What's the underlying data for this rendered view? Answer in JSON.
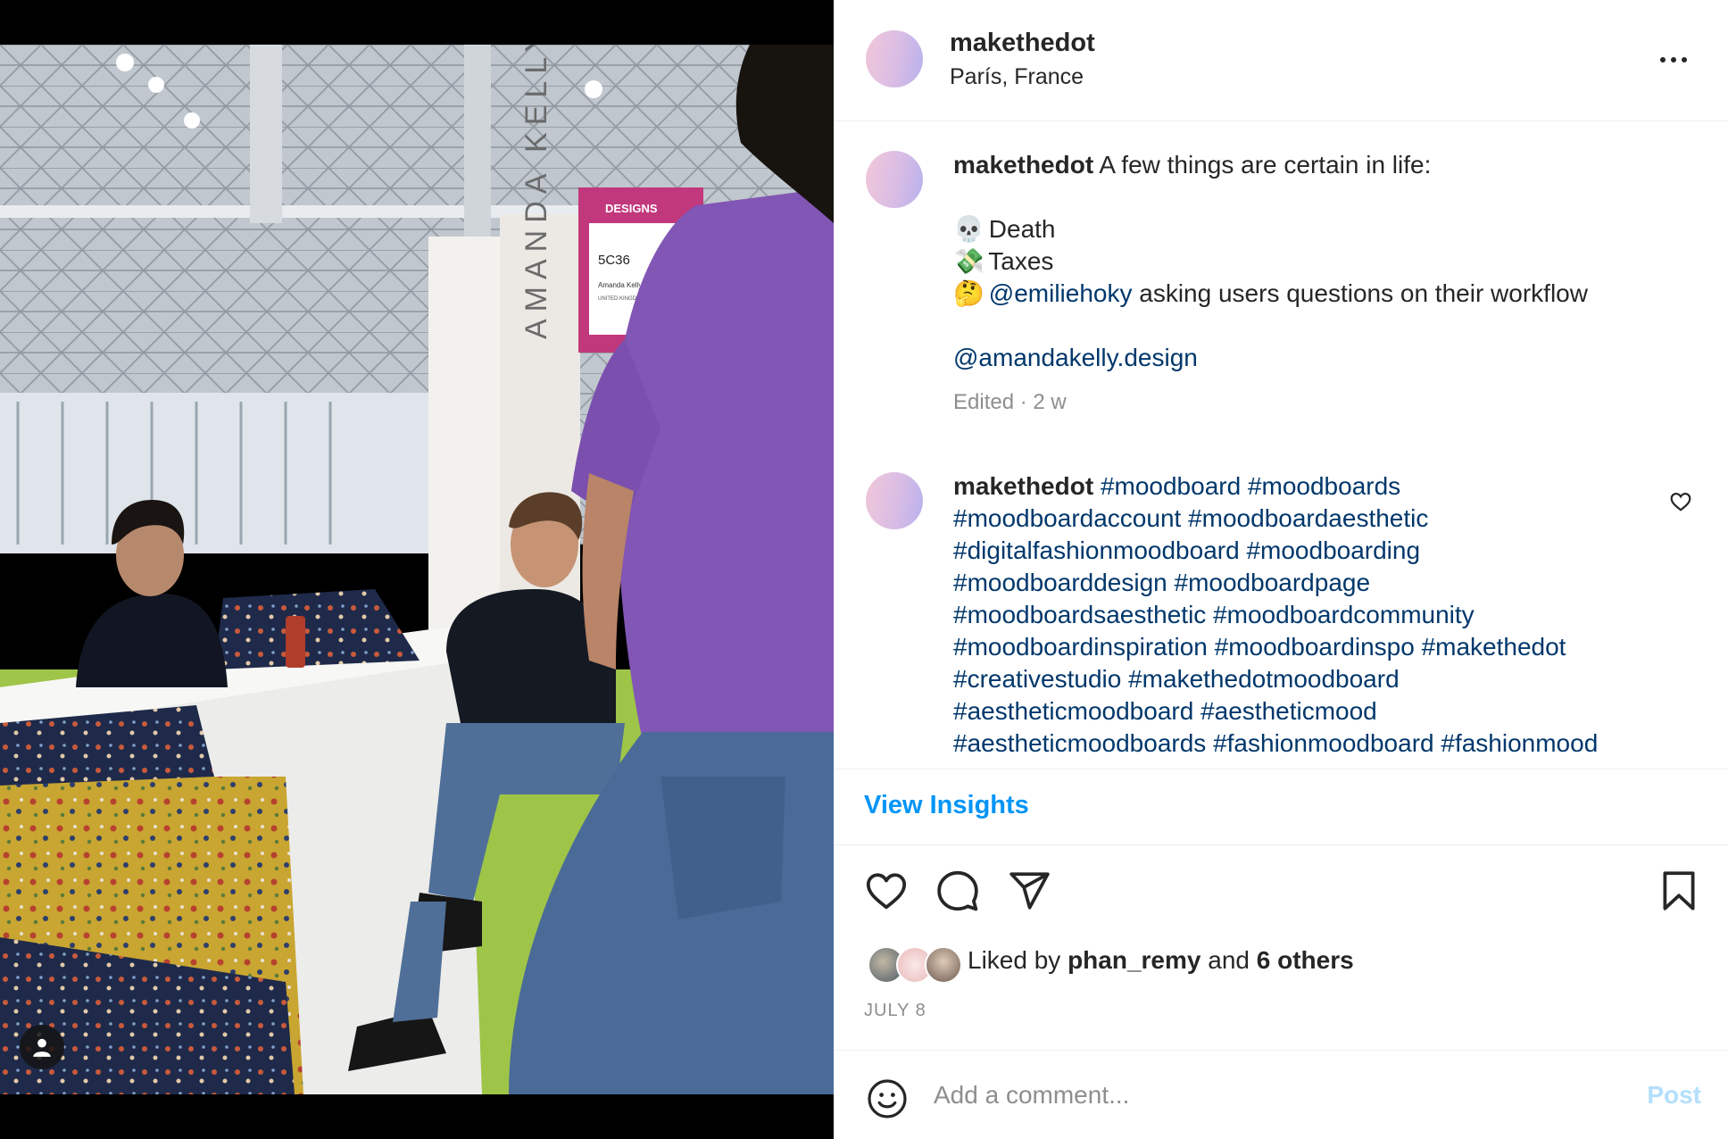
{
  "post": {
    "username": "makethedot",
    "location": "París, France"
  },
  "caption": {
    "username": "makethedot",
    "intro": "A few things are certain in life:",
    "items": [
      {
        "emoji": "💀",
        "text": "Death"
      },
      {
        "emoji": "💸",
        "text": "Taxes"
      },
      {
        "emoji": "🤔",
        "mention": "@emiliehoky",
        "text": "asking users questions on their workflow"
      }
    ],
    "mention_footer": "@amandakelly.design",
    "meta": "Edited · 2 w"
  },
  "hashtag_comment": {
    "username": "makethedot",
    "lines": [
      "#moodboard #moodboards",
      "#moodboardaccount #moodboardaesthetic",
      "#digitalfashionmoodboard #moodboarding",
      "#moodboarddesign #moodboardpage",
      "#moodboardsaesthetic #moodboardcommunity",
      "#moodboardinspiration #moodboardinspo #makethedot",
      "#creativestudio #makethedotmoodboard",
      "#aestheticmoodboard #aestheticmood",
      "#aestheticmoodboards #fashionmoodboard #fashionmood"
    ]
  },
  "insights": {
    "label": "View Insights"
  },
  "likes": {
    "prefix": "Liked by",
    "user": "phan_remy",
    "conjunction": "and",
    "others": "6 others"
  },
  "date": "JULY 8",
  "comment_form": {
    "placeholder": "Add a comment...",
    "post_label": "Post"
  },
  "photo_sign": {
    "brand": "DESIGNS",
    "booth": "5C36",
    "name": "Amanda Kelly",
    "country": "UNITED KINGDOM",
    "banner": "AMANDA KELLY"
  },
  "colors": {
    "link": "#00376b",
    "accent": "#0095f6",
    "post_disabled": "#b2dffc",
    "muted": "#8e8e8e"
  }
}
